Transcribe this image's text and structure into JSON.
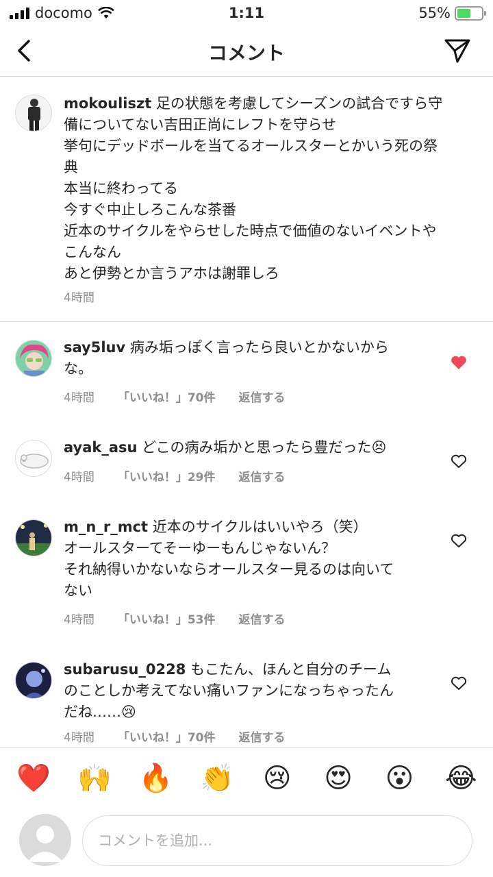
{
  "status_bar": {
    "carrier": "docomo",
    "time": "1:11",
    "battery": "55%",
    "battery_level": 0.55
  },
  "header": {
    "title": "コメント"
  },
  "caption": {
    "username": "mokouliszt",
    "text": " 足の状態を考慮してシーズンの試合ですら守\n備についてない吉田正尚にレフトを守らせ\n挙句にデッドボールを当てるオールスターとかいう死の祭\n典\n本当に終わってる\n今すぐ中止しろこんな茶番\n近本のサイクルをやらせした時点で価値のないイベントや\nこんなん\nあと伊勢とか言うアホは謝罪しろ",
    "time": "4時間"
  },
  "comments": [
    {
      "username": "say5luv",
      "text": " 病み垢っぽく言ったら良いとかないから\nな。",
      "time": "4時間",
      "likes": "「いいね！」70件",
      "reply": "返信する",
      "liked": true,
      "avatar_color": "#d15a8b"
    },
    {
      "username": "ayak_asu",
      "text": " どこの病み垢かと思ったら豊だった😣",
      "time": "4時間",
      "likes": "「いいね！」29件",
      "reply": "返信する",
      "liked": false,
      "avatar_color": "#f2f2f2"
    },
    {
      "username": "m_n_r_mct",
      "text": " 近本のサイクルはいいやろ（笑）\nオールスターてそーゆーもんじゃないん？\nそれ納得いかないならオールスター見るのは向いて\nない",
      "time": "4時間",
      "likes": "「いいね！」53件",
      "reply": "返信する",
      "liked": false,
      "avatar_color": "#3b4a5c"
    },
    {
      "username": "subarusu_0228",
      "text": " もこたん、ほんと自分のチーム\nのことしか考えてない痛いファンになっちゃったん\nだね……😢",
      "time": "4時間",
      "likes": "「いいね！」70件",
      "reply": "返信する",
      "liked": false,
      "avatar_color": "#2a2f5a"
    }
  ],
  "reactions": [
    "❤️",
    "🙌",
    "🔥",
    "👏",
    "😢",
    "😍",
    "😮",
    "😂"
  ],
  "composer": {
    "placeholder": "コメントを追加..."
  }
}
